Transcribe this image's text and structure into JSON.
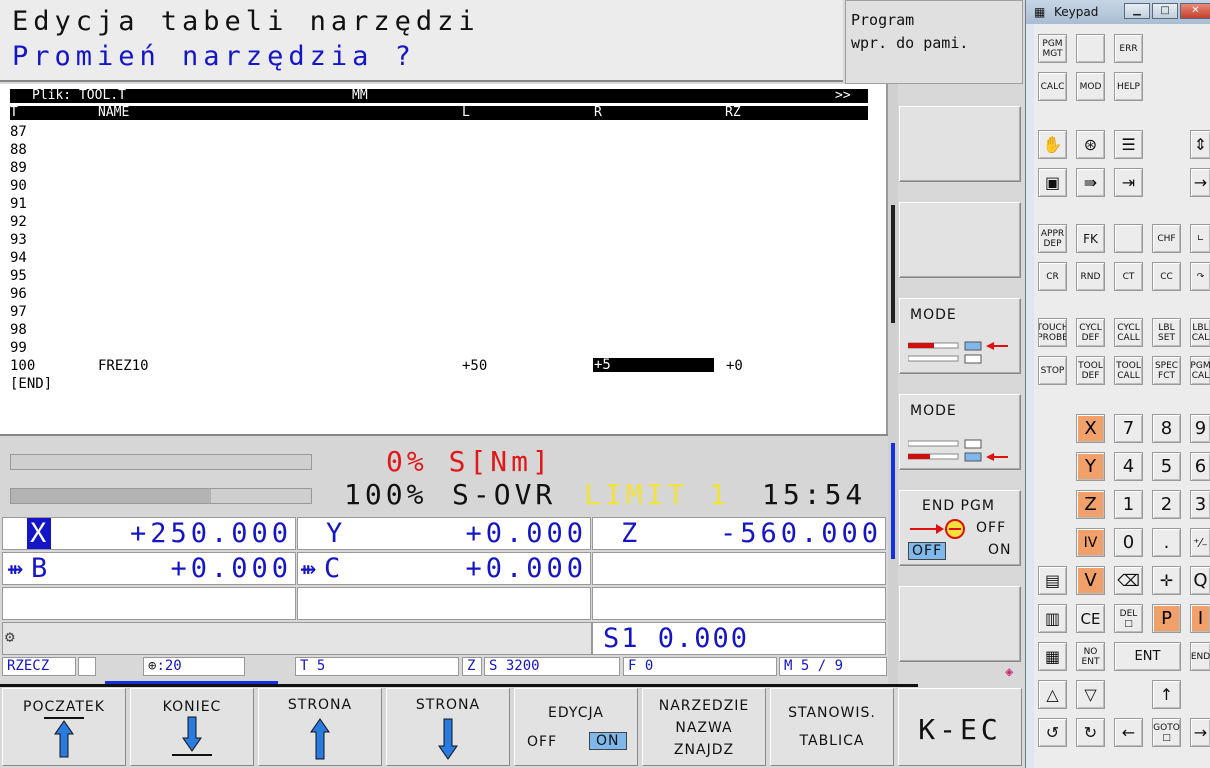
{
  "header": {
    "line1": "Edycja tabeli narzędzi",
    "line2": "Promień narzędzia ?",
    "mode_line1": "Program",
    "mode_line2": "wpr. do pami."
  },
  "table": {
    "title_bar": {
      "file": "Plik: TOOL.T",
      "unit": "MM",
      "more": ">>"
    },
    "columns": [
      "T",
      "NAME",
      "L",
      "R",
      "RZ"
    ],
    "rows": [
      {
        "t": "87"
      },
      {
        "t": "88"
      },
      {
        "t": "89"
      },
      {
        "t": "90"
      },
      {
        "t": "91"
      },
      {
        "t": "92"
      },
      {
        "t": "93"
      },
      {
        "t": "94"
      },
      {
        "t": "95"
      },
      {
        "t": "96"
      },
      {
        "t": "97"
      },
      {
        "t": "98"
      },
      {
        "t": "99"
      },
      {
        "t": "100",
        "name": "FREZ10",
        "l": "+50",
        "r": "+5",
        "rz": "+0"
      }
    ],
    "end_marker": "[END]"
  },
  "load": {
    "spindle_load_text": "0% S[Nm]",
    "spindle_load_value": 0,
    "override_value": 100,
    "override_pct": "100%",
    "override_label": "S-OVR",
    "limit_text": "LIMIT 1",
    "clock": "15:54"
  },
  "positions": {
    "x": {
      "label": "X",
      "value": "+250.000"
    },
    "y": {
      "label": "Y",
      "value": "+0.000"
    },
    "z": {
      "label": "Z",
      "value": "-560.000"
    },
    "b": {
      "label": "B",
      "value": "+0.000"
    },
    "c": {
      "label": "C",
      "value": "+0.000"
    },
    "spindle": "S1  0.000"
  },
  "status": {
    "mode": "RZECZ",
    "datum": ":20",
    "tool": "T 5",
    "axis": "Z",
    "speed": "S 3200",
    "feed": "F 0",
    "mfunc": "M 5 / 9"
  },
  "softkeys_right": {
    "mode1": "MODE",
    "mode2": "MODE",
    "endpgm": "END PGM",
    "endpgm_off": "OFF",
    "endpgm_off_sel": "OFF",
    "endpgm_on": "ON"
  },
  "softkeys_bottom": {
    "start": "POCZATEK",
    "end": "KONIEC",
    "page_up": "STRONA",
    "page_down": "STRONA",
    "edit": "EDYCJA",
    "edit_off": "OFF",
    "edit_on": "ON",
    "tool_find_1": "NARZEDZIE",
    "tool_find_2": "NAZWA",
    "tool_find_3": "ZNAJDZ",
    "station_1": "STANOWIS.",
    "station_2": "TABLICA",
    "k_ec": "K-EC"
  },
  "keypad": {
    "title": "Keypad",
    "keys": {
      "pgm_mgt_1": "PGM",
      "pgm_mgt_2": "MGT",
      "err": "ERR",
      "calc": "CALC",
      "mod": "MOD",
      "help": "HELP",
      "appr_1": "APPR",
      "appr_2": "DEP",
      "fk": "FK",
      "chf": "CHF",
      "cr": "CR",
      "rnd": "RND",
      "ct": "CT",
      "cc": "CC",
      "touch_1": "TOUCH",
      "touch_2": "PROBE",
      "cycl_def_1": "CYCL",
      "cycl_def_2": "DEF",
      "cycl_call_1": "CYCL",
      "cycl_call_2": "CALL",
      "lbl_set_1": "LBL",
      "lbl_set_2": "SET",
      "lbl_call_1": "LBL",
      "lbl_call_2": "CAL",
      "stop": "STOP",
      "tool_def_1": "TOOL",
      "tool_def_2": "DEF",
      "tool_call_1": "TOOL",
      "tool_call_2": "CALL",
      "spec_1": "SPEC",
      "spec_2": "FCT",
      "pgm_call_1": "PGM",
      "pgm_call_2": "CAL",
      "x": "X",
      "y": "Y",
      "z": "Z",
      "iv": "IV",
      "v": "V",
      "n7": "7",
      "n8": "8",
      "n9": "9",
      "n4": "4",
      "n5": "5",
      "n6": "6",
      "n1": "1",
      "n2": "2",
      "n3": "3",
      "n0": "0",
      "dot": ".",
      "pm": "⁺⁄₋",
      "q": "Q",
      "ce": "CE",
      "del_1": "DEL",
      "p": "P",
      "i": "I",
      "noent_1": "NO",
      "noent_2": "ENT",
      "ent": "ENT",
      "end": "END",
      "goto": "GOTO"
    }
  }
}
